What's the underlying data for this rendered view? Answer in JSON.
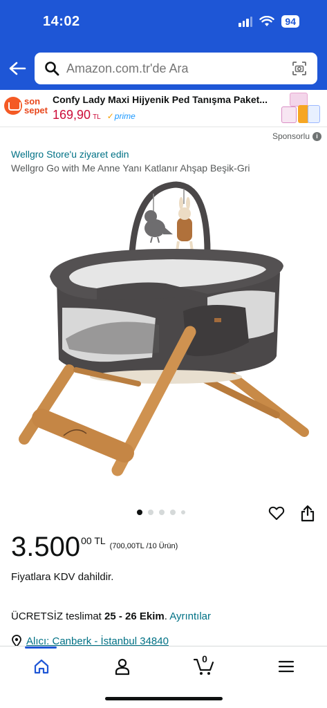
{
  "status": {
    "time": "14:02",
    "battery": "94"
  },
  "header": {
    "search_placeholder": "Amazon.com.tr'de Ara"
  },
  "ad": {
    "logo_line1": "son",
    "logo_line2": "sepet",
    "title": "Confy Lady Maxi Hijyenik Ped Tanışma Paket...",
    "price": "169,90",
    "currency": "TL",
    "prime_check": "✓",
    "prime_label": "prime"
  },
  "sponsor": {
    "label": "Sponsorlu",
    "info": "i"
  },
  "product": {
    "store_link": "Wellgro Store'u ziyaret edin",
    "title": "Wellgro Go with Me Anne Yanı Katlanır Ahşap Beşik-Gri",
    "image_count": 5,
    "active_image": 1,
    "price_main": "3.500",
    "price_fraction": "00 TL",
    "unit_price": "(700,00TL /10 Ürün)",
    "vat_note": "Fiyatlara KDV dahildir.",
    "delivery_prefix": "ÜCRETSİZ teslimat ",
    "delivery_dates": "25 - 26 Ekim",
    "delivery_sep": ". ",
    "delivery_link": "Ayrıntılar",
    "address_link": "Alıcı: Canberk - İstanbul 34840"
  },
  "nav": {
    "cart_count": "0",
    "items": [
      "home-icon",
      "account-icon",
      "cart-icon",
      "menu-icon"
    ]
  },
  "colors": {
    "header_blue": "#1e56d6",
    "link": "#007185",
    "price_red": "#cc0c39"
  }
}
